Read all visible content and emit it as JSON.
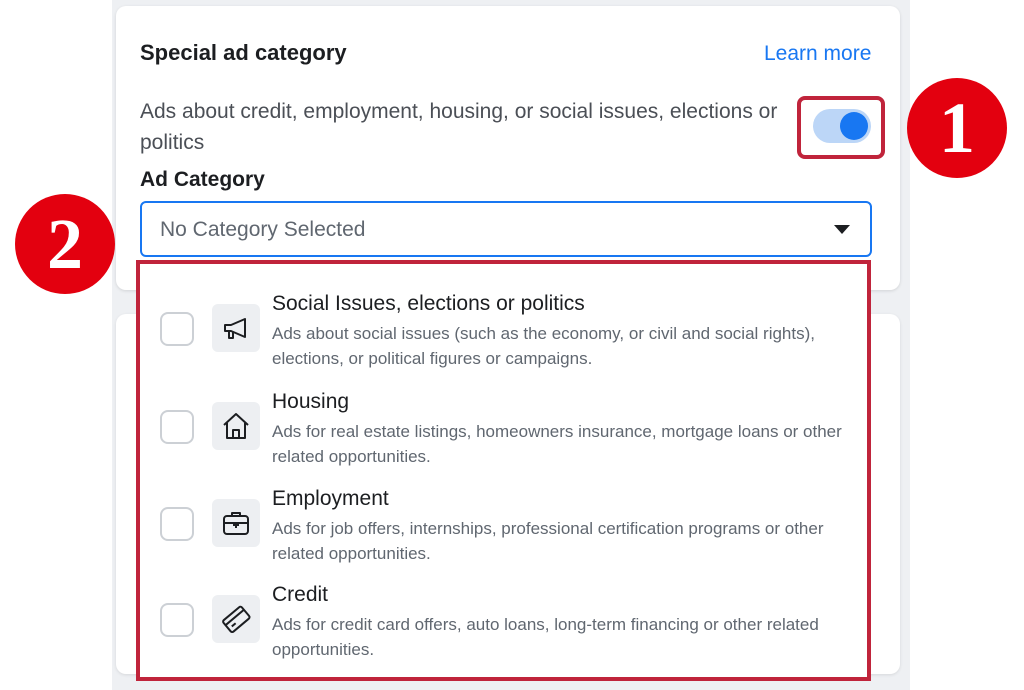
{
  "header": {
    "title": "Special ad category",
    "learn_more": "Learn more"
  },
  "toggle": {
    "label": "Ads about credit, employment, housing, or social issues, elections or politics",
    "on": true
  },
  "ad_category": {
    "label": "Ad Category",
    "selected": "No Category Selected"
  },
  "options": [
    {
      "title": "Social Issues, elections or politics",
      "description": "Ads about social issues (such as the economy, or civil and social rights), elections, or political figures or campaigns.",
      "icon": "megaphone-icon",
      "checked": false
    },
    {
      "title": "Housing",
      "description": "Ads for real estate listings, homeowners insurance, mortgage loans or other related opportunities.",
      "icon": "house-icon",
      "checked": false
    },
    {
      "title": "Employment",
      "description": "Ads for job offers, internships, professional certification programs or other related opportunities.",
      "icon": "briefcase-icon",
      "checked": false
    },
    {
      "title": "Credit",
      "description": "Ads for credit card offers, auto loans, long-term financing or other related opportunities.",
      "icon": "credit-card-icon",
      "checked": false
    }
  ],
  "annotations": {
    "badge_1": "1",
    "badge_2": "2"
  },
  "colors": {
    "accent": "#1877f2",
    "highlight": "#c0243b",
    "badge": "#e3000f"
  }
}
